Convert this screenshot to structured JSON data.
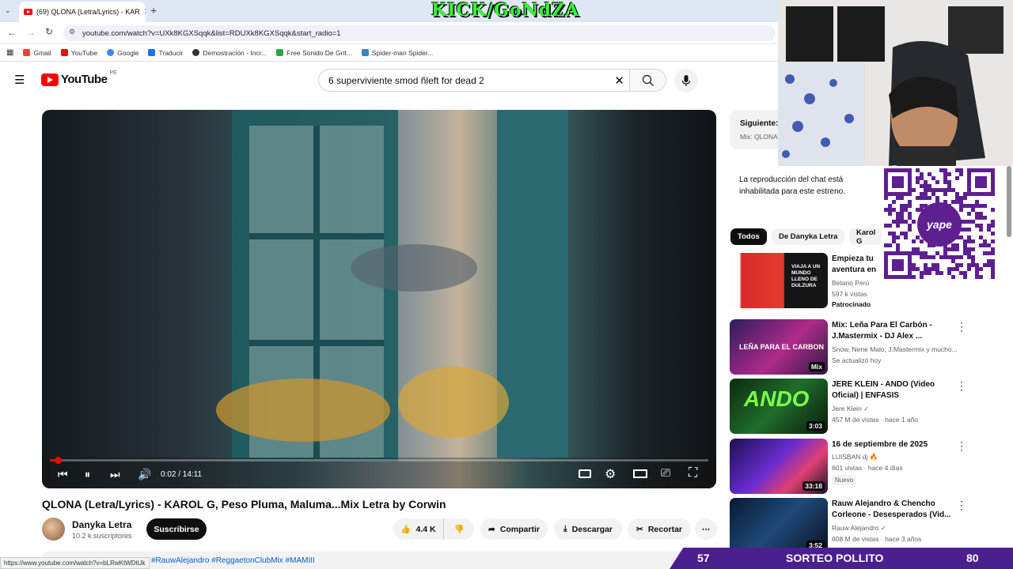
{
  "browser": {
    "tab_title": "(69) QLONA (Letra/Lyrics) - KAR",
    "url": "youtube.com/watch?v=UXk8KGXSqqk&list=RDUXk8KGXSqqk&start_radio=1",
    "bookmarks": [
      "Gmail",
      "YouTube",
      "Google",
      "Traducir",
      "Demostración - Incr...",
      "Free Sonido De Grit...",
      "Spider-man Spider..."
    ]
  },
  "overlay": {
    "stream_title": "KICK/GoNdZA",
    "qr_brand": "yape",
    "bottom_left_count": "57",
    "bottom_banner": "SORTEO POLLITO",
    "bottom_right_count": "80"
  },
  "youtube": {
    "logo_text": "YouTube",
    "region": "PE",
    "search_value": "6 superviviente smod ñleft for dead 2"
  },
  "player": {
    "time": "0:02 / 14:11",
    "progress": 0.003
  },
  "video": {
    "title": "QLONA (Letra/Lyrics) - KAROL G, Peso Pluma, Maluma...Mix Letra by Corwin",
    "channel": "Danyka Letra",
    "subscribers": "10.2 k suscriptores",
    "subscribe_label": "Suscribirse",
    "likes": "4.4 K",
    "share_label": "Compartir",
    "download_label": "Descargar",
    "clip_label": "Recortar",
    "hashtags": "#RauwAlejandro #ReggaetonClubMix #MAMIII"
  },
  "status_url": "https://www.youtube.com/watch?v=bLRwKtWDtUk",
  "sidebar": {
    "next_label": "Siguiente:",
    "next_sub": "Mix: QLONA",
    "chat_notice": "La reproducción del chat está inhabilitada para este estreno.",
    "chips": [
      "Todos",
      "De Danyka Letra",
      "Karol G"
    ],
    "videos": [
      {
        "title": "Empieza tu aventura en Candyland",
        "meta1": "Betano Perú",
        "meta2": "597 k vistas",
        "tag": "Patrocinado",
        "duration": "",
        "thumb_text": "VIAJA A UN MUNDO LLENO DE DULZURA"
      },
      {
        "title": "Mix: Leña Para El Carbón - J.Mastermix - DJ Alex ...",
        "meta1": "Snow, Nene Malo, J.Mastermix y mucho...",
        "meta2": "Se actualizó hoy",
        "tag": "",
        "duration": "Mix",
        "thumb_text": "LEÑA PARA EL CARBON"
      },
      {
        "title": "JERE KLEIN - ANDO (Video Oficial) | ENFASIS",
        "meta1": "Jere Klein ✓",
        "meta2": "457 M de vistas · hace 1 año",
        "tag": "",
        "duration": "3:03",
        "thumb_text": "ANDO"
      },
      {
        "title": "16 de septiembre de 2025",
        "meta1": "LUISBAN dj 🔥",
        "meta2": "601 vistas · hace 4 días",
        "tag": "Nuevo",
        "duration": "33:18",
        "thumb_text": ""
      },
      {
        "title": "Rauw Alejandro & Chencho Corleone - Desesperados (Vid...",
        "meta1": "Rauw Alejandro ✓",
        "meta2": "608 M de vistas · hace 3 años",
        "tag": "",
        "duration": "3:52",
        "thumb_text": ""
      }
    ]
  }
}
